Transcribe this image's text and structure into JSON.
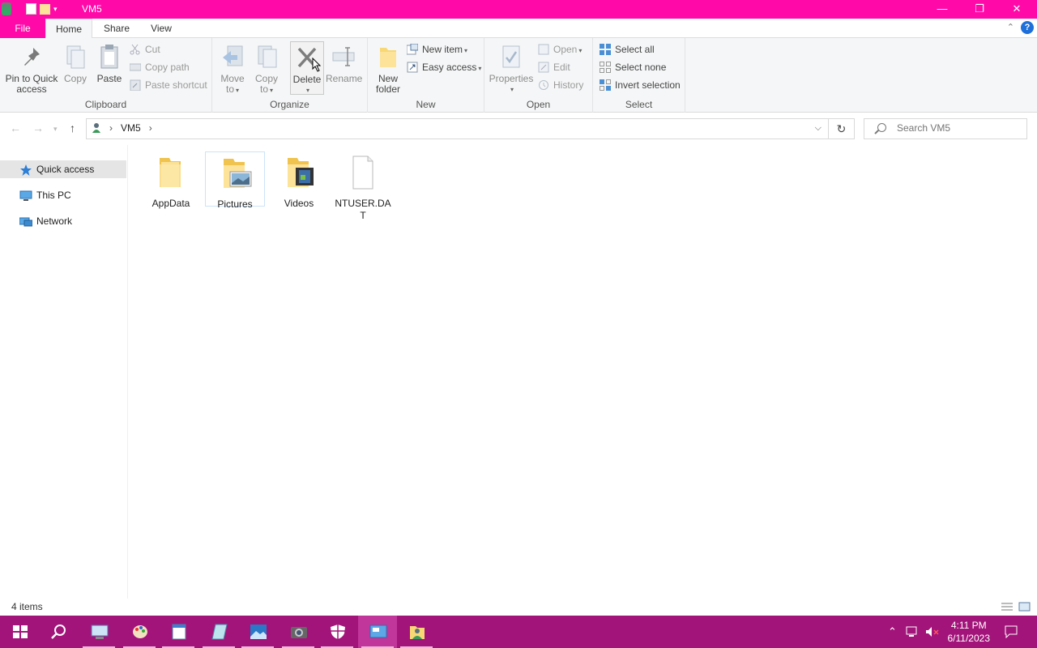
{
  "window": {
    "title": "VM5",
    "controls": {
      "minimize": "—",
      "restore": "❐",
      "close": "✕"
    }
  },
  "tabs": {
    "file": "File",
    "home": "Home",
    "share": "Share",
    "view": "View",
    "help": "?",
    "collapse": "⌃"
  },
  "ribbon": {
    "clipboard": {
      "label": "Clipboard",
      "pin_line1": "Pin to Quick",
      "pin_line2": "access",
      "copy": "Copy",
      "paste": "Paste",
      "cut": "Cut",
      "copy_path": "Copy path",
      "paste_shortcut": "Paste shortcut"
    },
    "organize": {
      "label": "Organize",
      "move_line1": "Move",
      "move_line2": "to",
      "copy_line1": "Copy",
      "copy_line2": "to",
      "delete": "Delete",
      "rename": "Rename"
    },
    "new": {
      "label": "New",
      "new_folder_line1": "New",
      "new_folder_line2": "folder",
      "new_item": "New item",
      "easy_access": "Easy access"
    },
    "open": {
      "label": "Open",
      "properties": "Properties",
      "open": "Open",
      "edit": "Edit",
      "history": "History"
    },
    "select": {
      "label": "Select",
      "select_all": "Select all",
      "select_none": "Select none",
      "invert_selection": "Invert selection"
    }
  },
  "address": {
    "crumb": "VM5",
    "search_placeholder": "Search VM5"
  },
  "navpane": {
    "items": [
      {
        "label": "Quick access"
      },
      {
        "label": "This PC"
      },
      {
        "label": "Network"
      }
    ]
  },
  "files": [
    {
      "name": "AppData"
    },
    {
      "name": "Pictures"
    },
    {
      "name": "Videos"
    },
    {
      "name": "NTUSER.DAT"
    }
  ],
  "status": {
    "count": "4 items"
  },
  "taskbar": {
    "time": "4:11 PM",
    "date": "6/11/2023"
  },
  "colors": {
    "titlebar": "#ff0aa8",
    "taskbar": "#a2147a"
  }
}
